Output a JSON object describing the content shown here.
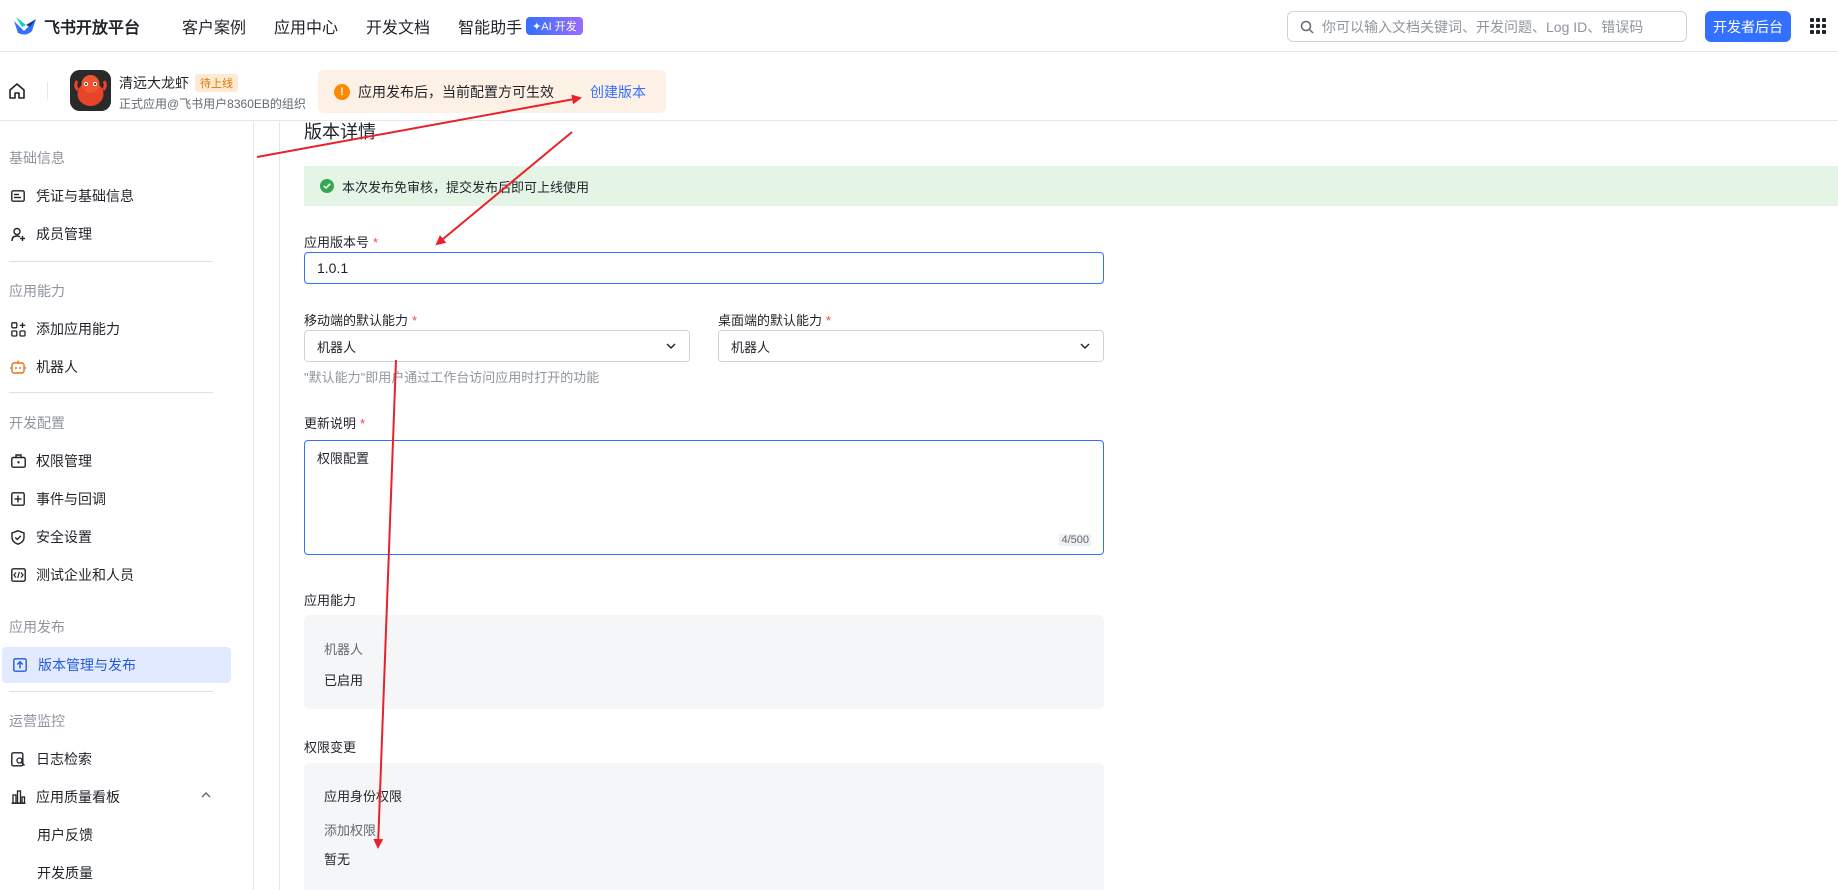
{
  "header": {
    "logo_text": "飞书开放平台",
    "nav": [
      "客户案例",
      "应用中心",
      "开发文档",
      "智能助手"
    ],
    "ai_badge": "✦AI 开发",
    "search_placeholder": "你可以输入文档关键词、开发问题、Log ID、错误码",
    "dev_console_label": "开发者后台"
  },
  "app": {
    "name": "清远大龙虾",
    "status": "待上线",
    "org": "正式应用@飞书用户8360EB的组织",
    "notice_text": "应用发布后，当前配置方可生效",
    "notice_link": "创建版本"
  },
  "sidebar": {
    "sections": [
      {
        "title": "基础信息",
        "items": [
          "凭证与基础信息",
          "成员管理"
        ]
      },
      {
        "title": "应用能力",
        "items": [
          "添加应用能力",
          "机器人"
        ]
      },
      {
        "title": "开发配置",
        "items": [
          "权限管理",
          "事件与回调",
          "安全设置",
          "测试企业和人员"
        ]
      },
      {
        "title": "应用发布",
        "items": [
          "版本管理与发布"
        ]
      },
      {
        "title": "运营监控",
        "items": [
          "日志检索",
          "应用质量看板",
          "用户反馈",
          "开发质量"
        ]
      }
    ],
    "active_item": "版本管理与发布"
  },
  "main": {
    "title": "版本详情",
    "success_banner": "本次发布免审核，提交发布后即可上线使用",
    "version_label": "应用版本号",
    "version_value": "1.0.1",
    "mobile_label": "移动端的默认能力",
    "mobile_value": "机器人",
    "desktop_label": "桌面端的默认能力",
    "desktop_value": "机器人",
    "default_hint": "\"默认能力\"即用户通过工作台访问应用时打开的功能",
    "notes_label": "更新说明",
    "notes_value": "权限配置",
    "notes_counter": "4/500",
    "capability_label": "应用能力",
    "capability_name": "机器人",
    "capability_status": "已启用",
    "permission_label": "权限变更",
    "permission_type": "应用身份权限",
    "permission_add_label": "添加权限",
    "permission_add_value": "暂无",
    "required_mark": "*"
  },
  "colors": {
    "primary": "#3370ff",
    "annotation": "#e8222a",
    "success_bg": "#e4f5e6",
    "notice_bg": "#fdf0e4"
  }
}
